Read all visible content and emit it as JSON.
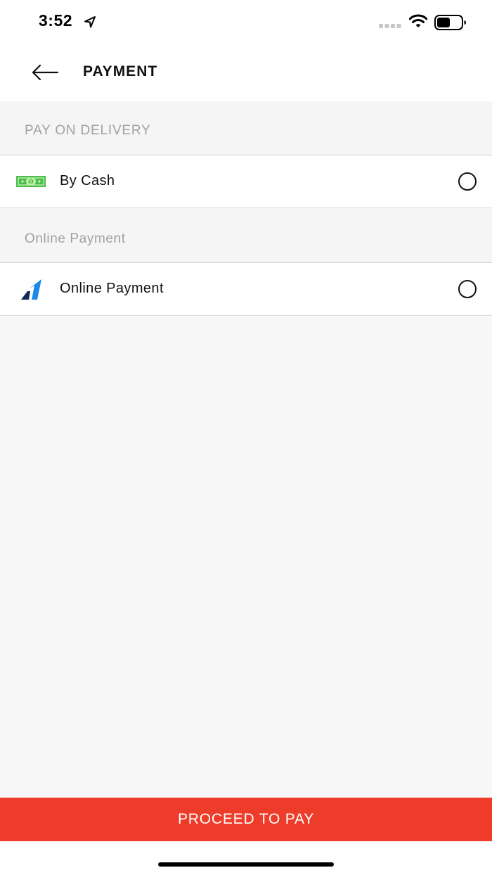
{
  "status_bar": {
    "time": "3:52",
    "icons": [
      "location-arrow-icon",
      "cellular-signal-icon",
      "wifi-icon",
      "battery-icon"
    ]
  },
  "header": {
    "back_icon": "arrow-left-icon",
    "title": "PAYMENT"
  },
  "sections": [
    {
      "label": "PAY ON DELIVERY",
      "options": [
        {
          "label": "By Cash",
          "icon": "cash-banknote-icon",
          "selected": false
        }
      ]
    },
    {
      "label": "Online Payment",
      "options": [
        {
          "label": "Online Payment",
          "icon": "online-payment-logo-icon",
          "selected": false
        }
      ]
    }
  ],
  "footer": {
    "proceed_label": "PROCEED TO PAY"
  },
  "colors": {
    "accent": "#ee3c2a",
    "background": "#f7f7f7",
    "section_label": "#a0a0a0",
    "cash_green": "#4bbf4a",
    "logo_navy": "#0f2b5b",
    "logo_blue": "#1e88e5"
  }
}
